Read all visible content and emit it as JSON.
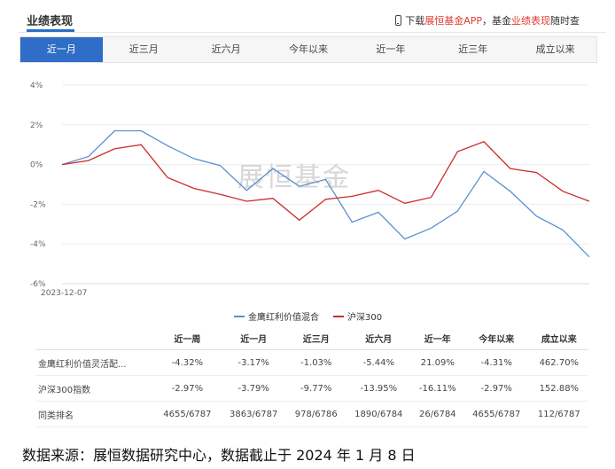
{
  "header": {
    "title": "业绩表现",
    "promo_prefix": "下载",
    "promo_app": "展恒基金APP",
    "promo_middle": "，基金",
    "promo_perf": "业绩表现",
    "promo_suffix": "随时查"
  },
  "tabs": [
    "近一月",
    "近三月",
    "近六月",
    "今年以来",
    "近一年",
    "近三年",
    "成立以来"
  ],
  "active_tab": 0,
  "watermark": "展恒基金",
  "colors": {
    "accent": "#2f6dc6",
    "fund_line": "#5b8fd0",
    "index_line": "#cc2b2b",
    "positive": "#e03c31",
    "negative": "#1f9d3a"
  },
  "chart_data": {
    "type": "line",
    "x_start_label": "2023-12-07",
    "yticks": [
      "4%",
      "2%",
      "0%",
      "-2%",
      "-4%",
      "-6%"
    ],
    "ylim": [
      -6,
      4
    ],
    "grid": true,
    "legend_position": "bottom",
    "series": [
      {
        "name": "金鹰红利价值混合",
        "values": [
          0,
          0.4,
          1.7,
          1.7,
          0.95,
          0.3,
          -0.05,
          -1.3,
          -0.2,
          -1.1,
          -0.75,
          -2.9,
          -2.4,
          -3.75,
          -3.2,
          -2.35,
          -0.35,
          -1.35,
          -2.6,
          -3.3,
          -4.65
        ]
      },
      {
        "name": "沪深300",
        "values": [
          0,
          0.2,
          0.8,
          1.0,
          -0.65,
          -1.2,
          -1.5,
          -1.85,
          -1.7,
          -2.8,
          -1.75,
          -1.6,
          -1.3,
          -1.95,
          -1.65,
          0.65,
          1.15,
          -0.2,
          -0.4,
          -1.35,
          -1.85
        ]
      }
    ]
  },
  "table": {
    "headers": [
      "",
      "近一周",
      "近一月",
      "近三月",
      "近六月",
      "近一年",
      "今年以来",
      "成立以来"
    ],
    "rows": [
      {
        "label": "金鹰红利价值灵活配...",
        "cells": [
          "-4.32%",
          "-3.17%",
          "-1.03%",
          "-5.44%",
          "21.09%",
          "-4.31%",
          "462.70%"
        ]
      },
      {
        "label": "沪深300指数",
        "cells": [
          "-2.97%",
          "-3.79%",
          "-9.77%",
          "-13.95%",
          "-16.11%",
          "-2.97%",
          "152.88%"
        ]
      },
      {
        "label": "同类排名",
        "cells": [
          "4655/6787",
          "3863/6787",
          "978/6786",
          "1890/6784",
          "26/6784",
          "4655/6787",
          "112/6787"
        ]
      }
    ]
  },
  "source_text": "数据来源：展恒数据研究中心，数据截止于 2024 年 1 月 8 日"
}
